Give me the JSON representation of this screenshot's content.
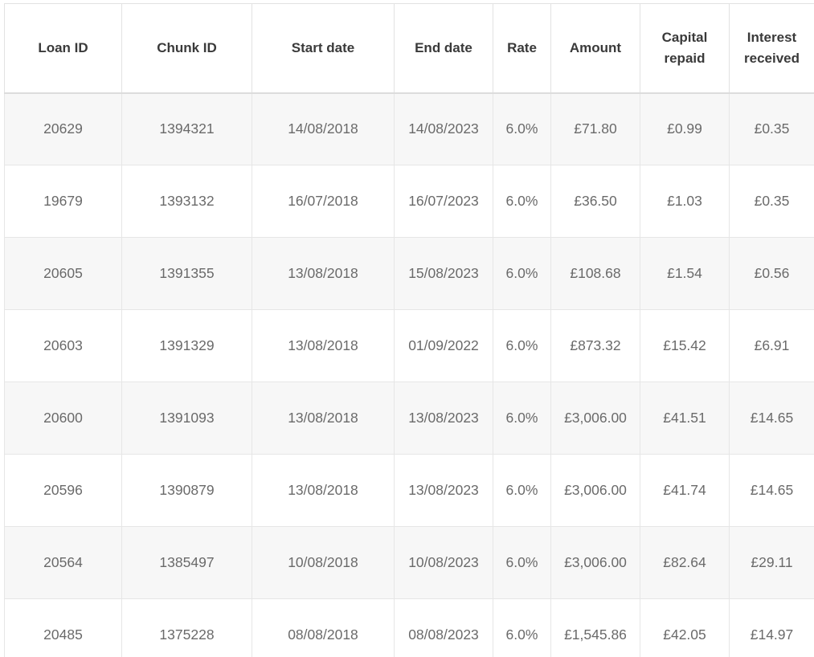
{
  "table": {
    "headers": [
      "Loan ID",
      "Chunk ID",
      "Start date",
      "End date",
      "Rate",
      "Amount",
      "Capital\nrepaid",
      "Interest\nreceived"
    ],
    "rows": [
      [
        "20629",
        "1394321",
        "14/08/2018",
        "14/08/2023",
        "6.0%",
        "£71.80",
        "£0.99",
        "£0.35"
      ],
      [
        "19679",
        "1393132",
        "16/07/2018",
        "16/07/2023",
        "6.0%",
        "£36.50",
        "£1.03",
        "£0.35"
      ],
      [
        "20605",
        "1391355",
        "13/08/2018",
        "15/08/2023",
        "6.0%",
        "£108.68",
        "£1.54",
        "£0.56"
      ],
      [
        "20603",
        "1391329",
        "13/08/2018",
        "01/09/2022",
        "6.0%",
        "£873.32",
        "£15.42",
        "£6.91"
      ],
      [
        "20600",
        "1391093",
        "13/08/2018",
        "13/08/2023",
        "6.0%",
        "£3,006.00",
        "£41.51",
        "£14.65"
      ],
      [
        "20596",
        "1390879",
        "13/08/2018",
        "13/08/2023",
        "6.0%",
        "£3,006.00",
        "£41.74",
        "£14.65"
      ],
      [
        "20564",
        "1385497",
        "10/08/2018",
        "10/08/2023",
        "6.0%",
        "£3,006.00",
        "£82.64",
        "£29.11"
      ],
      [
        "20485",
        "1375228",
        "08/08/2018",
        "08/08/2023",
        "6.0%",
        "£1,545.86",
        "£42.05",
        "£14.97"
      ]
    ]
  }
}
